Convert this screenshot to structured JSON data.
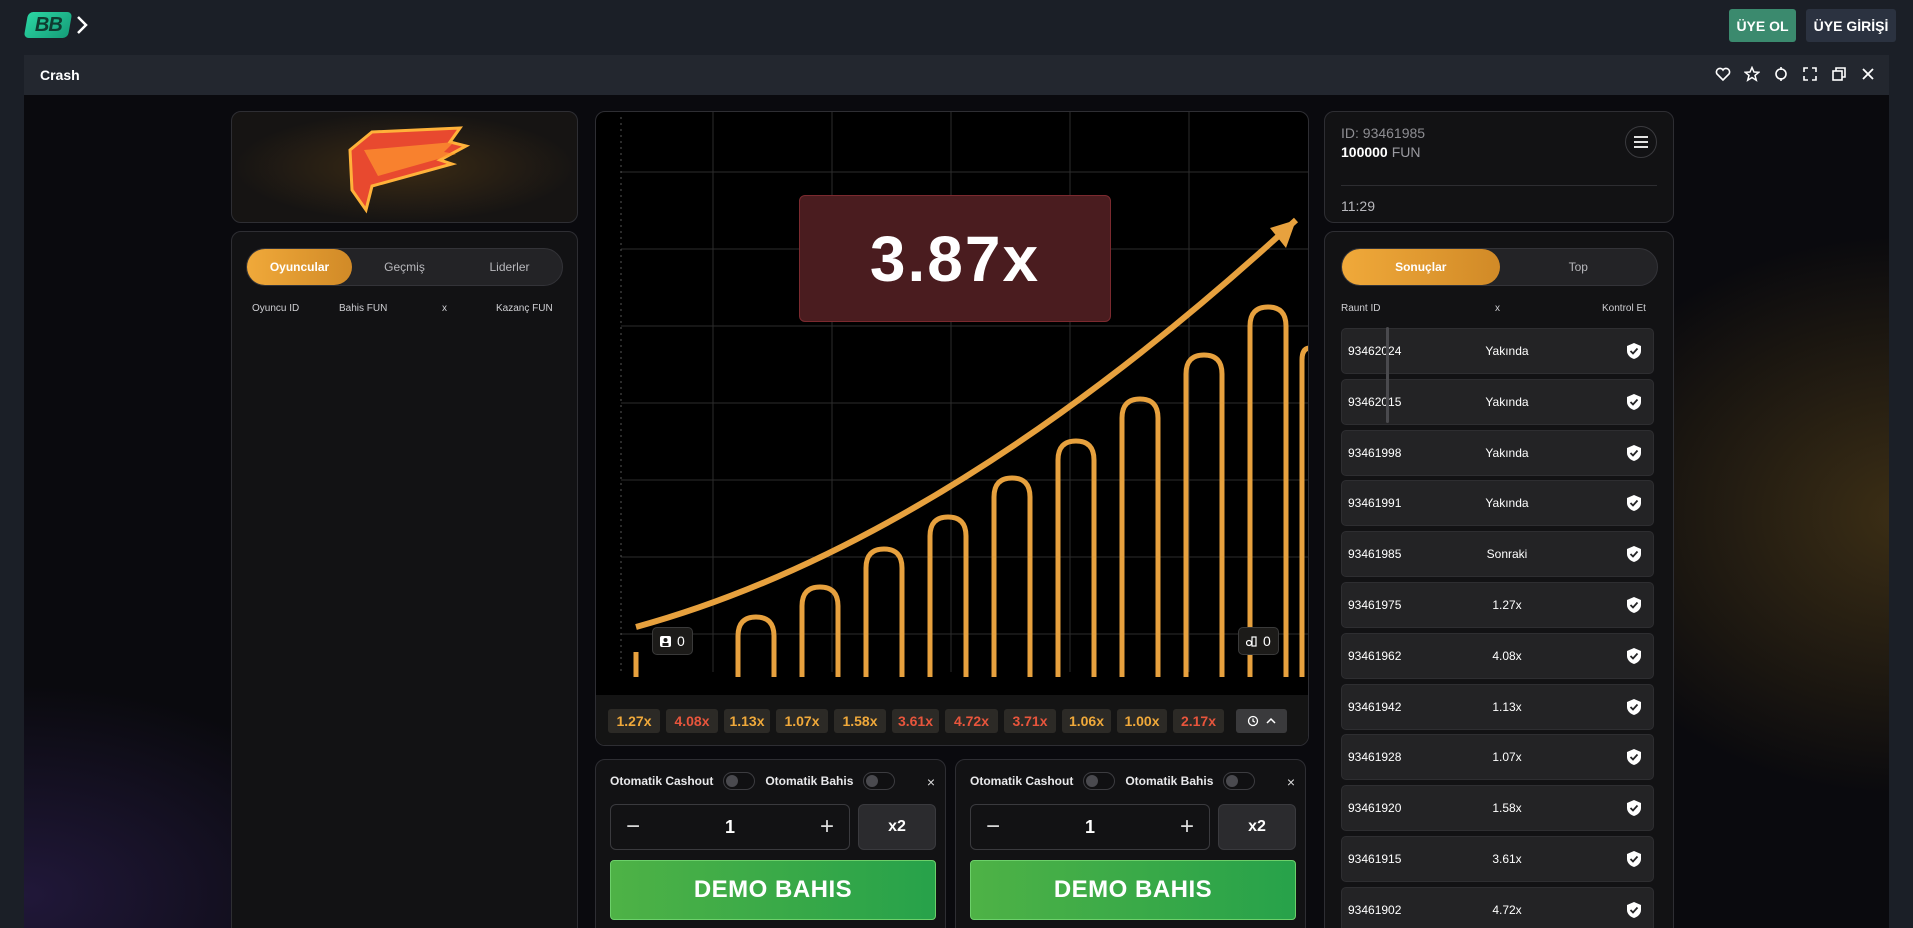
{
  "topbar": {
    "logo_text": "BB",
    "register_label": "ÜYE OL",
    "login_label": "ÜYE GİRİŞİ"
  },
  "window": {
    "title": "Crash"
  },
  "players": {
    "tabs": [
      "Oyuncular",
      "Geçmiş",
      "Liderler"
    ],
    "columns": {
      "player_id": "Oyuncu ID",
      "bet": "Bahis  FUN",
      "x": "x",
      "win": "Kazanç  FUN"
    }
  },
  "game": {
    "multiplier": "3.87x",
    "players_count": "0",
    "cashout_count": "0",
    "history": [
      {
        "v": "1.27x",
        "c": "#f0a93a"
      },
      {
        "v": "4.08x",
        "c": "#e8553c"
      },
      {
        "v": "1.13x",
        "c": "#f0a93a"
      },
      {
        "v": "1.07x",
        "c": "#f0a93a"
      },
      {
        "v": "1.58x",
        "c": "#f0a93a"
      },
      {
        "v": "3.61x",
        "c": "#e8553c"
      },
      {
        "v": "4.72x",
        "c": "#e8553c"
      },
      {
        "v": "3.71x",
        "c": "#e8553c"
      },
      {
        "v": "1.06x",
        "c": "#f0a93a"
      },
      {
        "v": "1.00x",
        "c": "#f0a93a"
      },
      {
        "v": "2.17x",
        "c": "#e8553c"
      }
    ]
  },
  "bet1": {
    "auto_cashout": "Otomatik Cashout",
    "auto_bet": "Otomatik Bahis",
    "close": "×",
    "amount": "1",
    "minus": "−",
    "plus": "+",
    "x2": "x2",
    "demo": "DEMO BAHIS"
  },
  "bet2": {
    "auto_cashout": "Otomatik Cashout",
    "auto_bet": "Otomatik Bahis",
    "close": "×",
    "amount": "1",
    "minus": "−",
    "plus": "+",
    "x2": "x2",
    "demo": "DEMO BAHIS"
  },
  "account": {
    "id": "ID: 93461985",
    "balance": "100000",
    "currency": "FUN",
    "time": "11:29"
  },
  "results": {
    "tabs": [
      "Sonuçlar",
      "Top"
    ],
    "columns": {
      "round": "Raunt ID",
      "x": "x",
      "check": "Kontrol Et"
    },
    "rows": [
      {
        "id": "93462024",
        "x": "Yakında"
      },
      {
        "id": "93462015",
        "x": "Yakında"
      },
      {
        "id": "93461998",
        "x": "Yakında"
      },
      {
        "id": "93461991",
        "x": "Yakında"
      },
      {
        "id": "93461985",
        "x": "Sonraki"
      },
      {
        "id": "93461975",
        "x": "1.27x"
      },
      {
        "id": "93461962",
        "x": "4.08x"
      },
      {
        "id": "93461942",
        "x": "1.13x"
      },
      {
        "id": "93461928",
        "x": "1.07x"
      },
      {
        "id": "93461920",
        "x": "1.58x"
      },
      {
        "id": "93461915",
        "x": "3.61x"
      },
      {
        "id": "93461902",
        "x": "4.72x"
      }
    ]
  },
  "colors": {
    "accent": "#f0a93a",
    "green": "#4eb246",
    "red": "#e8553c"
  }
}
